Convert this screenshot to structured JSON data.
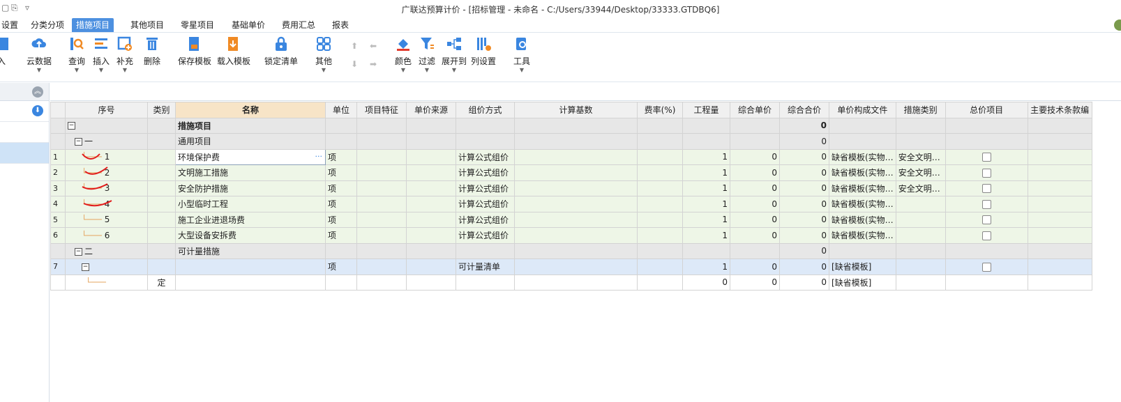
{
  "window": {
    "title": "广联达预算计价 - [招标管理 - 未命名 - C:/Users/33944/Desktop/33333.GTDBQ6]"
  },
  "menu": [
    {
      "label": "设置"
    },
    {
      "label": "分类分项"
    },
    {
      "label": "措施项目",
      "active": true
    },
    {
      "label": "其他项目"
    },
    {
      "label": "零星项目"
    },
    {
      "label": "基础单价"
    },
    {
      "label": "费用汇总"
    },
    {
      "label": "报表"
    }
  ],
  "toolbar": {
    "import_partial": "入",
    "cloud_data": "云数据",
    "query": "查询",
    "insert": "插入",
    "supplement": "补充",
    "delete": "删除",
    "save_template": "保存模板",
    "load_template": "载入模板",
    "lock_list": "锁定清单",
    "other": "其他",
    "color": "颜色",
    "filter": "过滤",
    "expand_to": "展开到",
    "column_settings": "列设置",
    "tools": "工具"
  },
  "grid": {
    "headers": [
      "序号",
      "类别",
      "名称",
      "单位",
      "项目特征",
      "单价来源",
      "组价方式",
      "计算基数",
      "费率(%)",
      "工程量",
      "综合单价",
      "综合合价",
      "单价构成文件",
      "措施类别",
      "总价项目",
      "主要技术条款编"
    ],
    "rows": [
      {
        "rn": "",
        "seq": "",
        "cat": "",
        "name": "措施项目",
        "unit": "",
        "method": "",
        "qty": "",
        "uprice": "",
        "total": "0",
        "file": "",
        "mcat": "",
        "style": "gray",
        "bold": true,
        "level": 0,
        "check": false
      },
      {
        "rn": "",
        "seq": "一",
        "cat": "",
        "name": "通用项目",
        "unit": "",
        "method": "",
        "qty": "",
        "uprice": "",
        "total": "0",
        "file": "",
        "mcat": "",
        "style": "gray",
        "level": 1,
        "check": false
      },
      {
        "rn": "1",
        "seq": "1",
        "cat": "",
        "name": "环境保护费",
        "unit": "项",
        "method": "计算公式组价",
        "qty": "1",
        "uprice": "0",
        "total": "0",
        "file": "缺省模板(实物…",
        "mcat": "安全文明…",
        "style": "green",
        "level": 2,
        "check": true,
        "editing": true
      },
      {
        "rn": "2",
        "seq": "2",
        "cat": "",
        "name": "文明施工措施",
        "unit": "项",
        "method": "计算公式组价",
        "qty": "1",
        "uprice": "0",
        "total": "0",
        "file": "缺省模板(实物…",
        "mcat": "安全文明…",
        "style": "green",
        "level": 2,
        "check": true
      },
      {
        "rn": "3",
        "seq": "3",
        "cat": "",
        "name": "安全防护措施",
        "unit": "项",
        "method": "计算公式组价",
        "qty": "1",
        "uprice": "0",
        "total": "0",
        "file": "缺省模板(实物…",
        "mcat": "安全文明…",
        "style": "green",
        "level": 2,
        "check": true
      },
      {
        "rn": "4",
        "seq": "4",
        "cat": "",
        "name": "小型临时工程",
        "unit": "项",
        "method": "计算公式组价",
        "qty": "1",
        "uprice": "0",
        "total": "0",
        "file": "缺省模板(实物…",
        "mcat": "",
        "style": "green",
        "level": 2,
        "check": true
      },
      {
        "rn": "5",
        "seq": "5",
        "cat": "",
        "name": "施工企业进退场费",
        "unit": "项",
        "method": "计算公式组价",
        "qty": "1",
        "uprice": "0",
        "total": "0",
        "file": "缺省模板(实物…",
        "mcat": "",
        "style": "green",
        "level": 2,
        "check": true
      },
      {
        "rn": "6",
        "seq": "6",
        "cat": "",
        "name": "大型设备安拆费",
        "unit": "项",
        "method": "计算公式组价",
        "qty": "1",
        "uprice": "0",
        "total": "0",
        "file": "缺省模板(实物…",
        "mcat": "",
        "style": "green",
        "level": 2,
        "check": true
      },
      {
        "rn": "",
        "seq": "二",
        "cat": "",
        "name": "可计量措施",
        "unit": "",
        "method": "",
        "qty": "",
        "uprice": "",
        "total": "0",
        "file": "",
        "mcat": "",
        "style": "gray",
        "level": 1,
        "check": false
      },
      {
        "rn": "7",
        "seq": "",
        "cat": "",
        "name": "",
        "unit": "项",
        "method": "可计量清单",
        "qty": "1",
        "uprice": "0",
        "total": "0",
        "file": "[缺省模板]",
        "mcat": "",
        "style": "blue",
        "level": 2,
        "check": true,
        "box": true
      },
      {
        "rn": "",
        "seq": "",
        "cat": "定",
        "name": "",
        "unit": "",
        "method": "",
        "qty": "0",
        "uprice": "0",
        "total": "0",
        "file": "[缺省模板]",
        "mcat": "",
        "style": "white",
        "level": 3,
        "check": false
      }
    ]
  }
}
